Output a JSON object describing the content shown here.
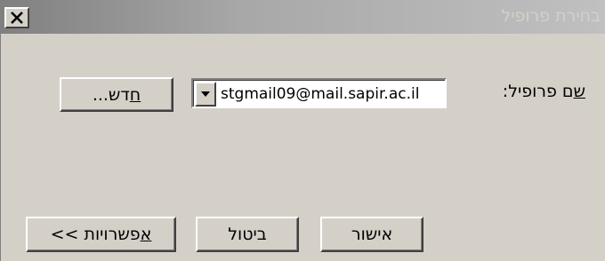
{
  "window": {
    "title": "בחירת פרופיל"
  },
  "form": {
    "profile_label_accel": "ש",
    "profile_label_rest": "ם פרופיל:",
    "profile_value": "stgmail09@mail.sapir.ac.il"
  },
  "buttons": {
    "new_accel": "ח",
    "new_rest": "דש...",
    "ok": "אישור",
    "cancel": "ביטול",
    "options_accel": "א",
    "options_rest": "פשרויות >>"
  },
  "icons": {
    "close": "close-icon",
    "dropdown": "chevron-down-icon"
  }
}
